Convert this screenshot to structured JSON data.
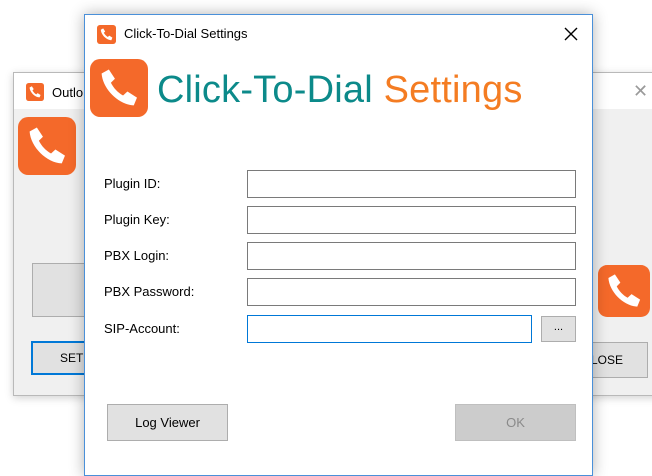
{
  "background_window": {
    "title": "Outlo",
    "left_button_label": "SET",
    "right_button_label": "LOSE"
  },
  "dialog": {
    "title": "Click-To-Dial Settings",
    "banner": {
      "part1": "Click-To-Dial",
      "part2": "Settings"
    },
    "fields": [
      {
        "label": "Plugin ID:",
        "value": ""
      },
      {
        "label": "Plugin Key:",
        "value": ""
      },
      {
        "label": "PBX Login:",
        "value": ""
      },
      {
        "label": "PBX Password:",
        "value": ""
      },
      {
        "label": "SIP-Account:",
        "value": ""
      }
    ],
    "browse_label": "...",
    "log_viewer_label": "Log Viewer",
    "ok_label": "OK"
  },
  "colors": {
    "brand_orange": "#f47c22",
    "brand_teal": "#0c8a8a",
    "focus_blue": "#0078d7"
  },
  "icons": [
    "phone-icon",
    "close-icon"
  ]
}
